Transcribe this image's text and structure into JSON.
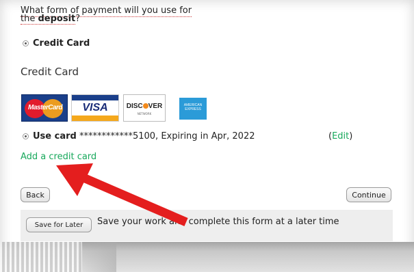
{
  "question": {
    "line1": "What form of payment will you use for",
    "line2_prefix": "the ",
    "line2_bold": "deposit",
    "line2_suffix": "?"
  },
  "payment_method": {
    "label": "Credit Card",
    "selected": true
  },
  "section_title": "Credit Card",
  "card_logos": [
    {
      "name": "mastercard",
      "text": "MasterCard"
    },
    {
      "name": "visa",
      "text": "VISA"
    },
    {
      "name": "discover",
      "text": "DISC",
      "text2": "VER",
      "subtext": "NETWORK"
    },
    {
      "name": "amex",
      "text": "AMERICAN",
      "text2": "EXPRESS"
    }
  ],
  "saved_card": {
    "label": "Use card",
    "details": " ************5100, Expiring in Apr, 2022",
    "edit_open": "(",
    "edit_label": "Edit",
    "edit_close": ")"
  },
  "add_card_label": "Add a credit card",
  "buttons": {
    "back": "Back",
    "continue": "Continue",
    "save_for_later": "Save for Later"
  },
  "save_later_text": "Save your work and complete this form at a later time",
  "colors": {
    "link": "#17a85b",
    "arrow": "#e41e1e",
    "panel_bg": "#eeeeee"
  }
}
